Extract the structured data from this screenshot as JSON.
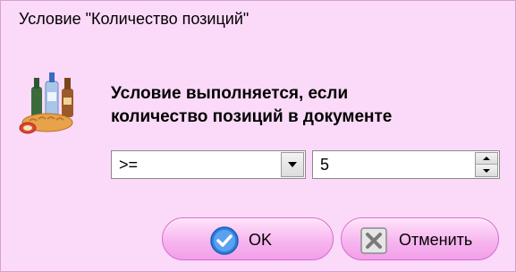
{
  "window": {
    "title": "Условие \"Количество позиций\""
  },
  "icons": {
    "header_icon": "bottles-and-bread-icon",
    "ok_icon": "check-icon",
    "cancel_icon": "cross-icon"
  },
  "prompt": {
    "line1": "Условие выполняется, если",
    "line2": "количество позиций в документе"
  },
  "operator_select": {
    "value": ">="
  },
  "count_field": {
    "value": "5"
  },
  "buttons": {
    "ok_label": "OK",
    "cancel_label": "Отменить"
  },
  "colors": {
    "dialog_background": "#fbd9f8",
    "button_pink": "#f7b6ef",
    "ok_icon_blue": "#2f7fe0"
  }
}
